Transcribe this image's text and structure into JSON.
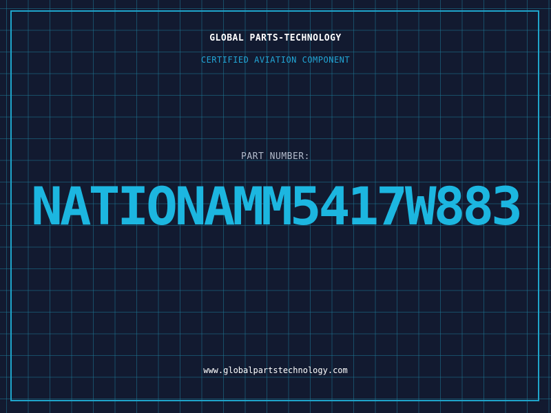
{
  "header": {
    "company": "GLOBAL PARTS-TECHNOLOGY",
    "subtitle": "CERTIFIED AVIATION COMPONENT"
  },
  "part": {
    "label": "PART NUMBER:",
    "number": "NATIONAMM5417W883"
  },
  "footer": {
    "website": "www.globalpartstechnology.com"
  },
  "colors": {
    "background": "#121a30",
    "grid": "#1e7896",
    "frame": "#1fa6cc",
    "accent": "#1cb6e0",
    "text": "#ffffff",
    "label": "#b4bccc"
  }
}
